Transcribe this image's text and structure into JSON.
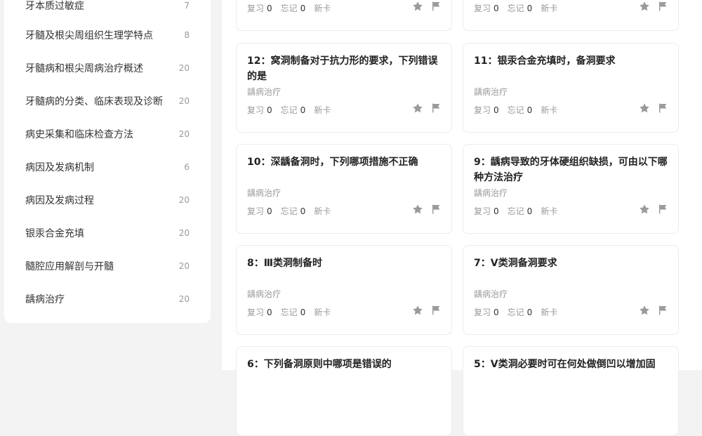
{
  "sidebar": {
    "items": [
      {
        "label": "牙本质过敏症",
        "count": "7"
      },
      {
        "label": "牙髓及根尖周组织生理学特点",
        "count": "8"
      },
      {
        "label": "牙髓病和根尖周病治疗概述",
        "count": "20"
      },
      {
        "label": "牙髓病的分类、临床表现及诊断",
        "count": "20"
      },
      {
        "label": "病史采集和临床检查方法",
        "count": "20"
      },
      {
        "label": "病因及发病机制",
        "count": "6"
      },
      {
        "label": "病因及发病过程",
        "count": "20"
      },
      {
        "label": "银汞合金充填",
        "count": "20"
      },
      {
        "label": "髓腔应用解剖与开髓",
        "count": "20"
      },
      {
        "label": "龋病治疗",
        "count": "20"
      }
    ]
  },
  "cards": [
    {
      "title": "",
      "tag": "",
      "review_label": "复习",
      "review": "0",
      "forget_label": "忘记",
      "forget": "0",
      "new_label": "新卡"
    },
    {
      "title": "",
      "tag": "",
      "review_label": "复习",
      "review": "0",
      "forget_label": "忘记",
      "forget": "0",
      "new_label": "新卡"
    },
    {
      "title": "12：窝洞制备对于抗力形的要求，下列错误的是",
      "tag": "龋病治疗",
      "review_label": "复习",
      "review": "0",
      "forget_label": "忘记",
      "forget": "0",
      "new_label": "新卡"
    },
    {
      "title": "11：银汞合金充填时，备洞要求",
      "tag": "龋病治疗",
      "review_label": "复习",
      "review": "0",
      "forget_label": "忘记",
      "forget": "0",
      "new_label": "新卡"
    },
    {
      "title": "10：深龋备洞时，下列哪项措施不正确",
      "tag": "龋病治疗",
      "review_label": "复习",
      "review": "0",
      "forget_label": "忘记",
      "forget": "0",
      "new_label": "新卡"
    },
    {
      "title": "9：龋病导致的牙体硬组织缺损，可由以下哪种方法治疗",
      "tag": "龋病治疗",
      "review_label": "复习",
      "review": "0",
      "forget_label": "忘记",
      "forget": "0",
      "new_label": "新卡"
    },
    {
      "title": "8：Ⅲ类洞制备时",
      "tag": "龋病治疗",
      "review_label": "复习",
      "review": "0",
      "forget_label": "忘记",
      "forget": "0",
      "new_label": "新卡"
    },
    {
      "title": "7：Ⅴ类洞备洞要求",
      "tag": "龋病治疗",
      "review_label": "复习",
      "review": "0",
      "forget_label": "忘记",
      "forget": "0",
      "new_label": "新卡"
    },
    {
      "title": "6：下列备洞原则中哪项是错误的",
      "tag": "",
      "review_label": "",
      "review": "",
      "forget_label": "",
      "forget": "",
      "new_label": ""
    },
    {
      "title": "5：Ⅴ类洞必要时可在何处做倒凹以增加固",
      "tag": "",
      "review_label": "",
      "review": "",
      "forget_label": "",
      "forget": "",
      "new_label": ""
    }
  ],
  "icons": {
    "star": "star-icon",
    "flag": "flag-icon"
  },
  "colors": {
    "icon": "#9a9a9a",
    "page_bg": "#f3f3f3"
  }
}
